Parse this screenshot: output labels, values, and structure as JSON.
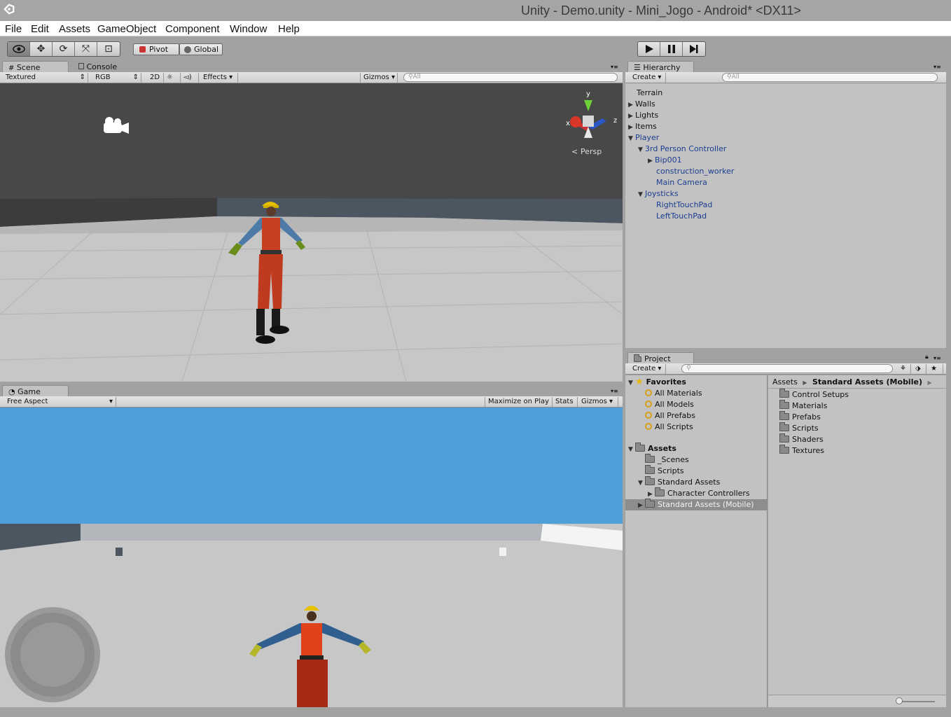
{
  "window": {
    "title": "Unity - Demo.unity - Mini_Jogo - Android* <DX11>"
  },
  "menu": [
    "File",
    "Edit",
    "Assets",
    "GameObject",
    "Component",
    "Window",
    "Help"
  ],
  "toolbar": {
    "pivot_label": "Pivot",
    "global_label": "Global"
  },
  "scene": {
    "tab_label": "Scene",
    "console_tab_label": "Console",
    "shading_mode": "Textured",
    "render_mode": "RGB",
    "mode_2d": "2D",
    "effects_label": "Effects",
    "gizmos_label": "Gizmos",
    "search_placeholder": "All",
    "gizmo_y": "y",
    "gizmo_z": "z",
    "gizmo_x": "x",
    "persp_label": "Persp"
  },
  "game": {
    "tab_label": "Game",
    "aspect": "Free Aspect",
    "maximize_label": "Maximize on Play",
    "stats_label": "Stats",
    "gizmos_label": "Gizmos"
  },
  "hierarchy": {
    "tab_label": "Hierarchy",
    "create_label": "Create",
    "search_placeholder": "All",
    "items": [
      "Terrain",
      "Walls",
      "Lights",
      "Items",
      "Player",
      "3rd Person Controller",
      "Bip001",
      "construction_worker",
      "Main Camera",
      "Joysticks",
      "RightTouchPad",
      "LeftTouchPad"
    ]
  },
  "project": {
    "tab_label": "Project",
    "create_label": "Create",
    "favorites_label": "Favorites",
    "favorites": [
      "All Materials",
      "All Models",
      "All Prefabs",
      "All Scripts"
    ],
    "assets_label": "Assets",
    "asset_tree": [
      "_Scenes",
      "Scripts",
      "Standard Assets",
      "Character Controllers",
      "Standard Assets (Mobile)"
    ],
    "breadcrumb_root": "Assets",
    "breadcrumb_current": "Standard Assets (Mobile)",
    "folder_contents": [
      "Control Setups",
      "Materials",
      "Prefabs",
      "Scripts",
      "Shaders",
      "Textures"
    ]
  },
  "colors": {
    "sky": "#4f9fd9",
    "selected_row": "#8d8d8d",
    "blue_text": "#1b3d8f"
  }
}
